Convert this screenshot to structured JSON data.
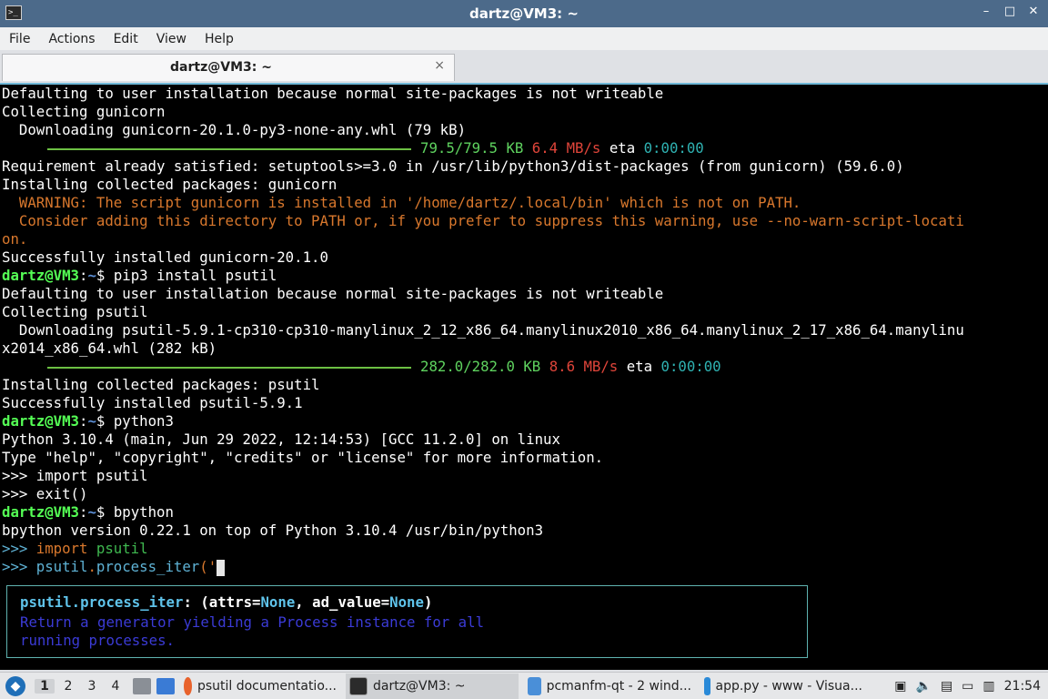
{
  "window": {
    "title": "dartz@VM3: ~",
    "min": "–",
    "max": "□",
    "close": "✕"
  },
  "menu": [
    "File",
    "Actions",
    "Edit",
    "View",
    "Help"
  ],
  "tab": {
    "label": "dartz@VM3: ~",
    "close": "×"
  },
  "prompt": {
    "user": "dartz@VM3",
    "path": "~",
    "sep": ":",
    "dollar": "$"
  },
  "lines": {
    "l1": "Defaulting to user installation because normal site-packages is not writeable",
    "l2": "Collecting gunicorn",
    "l3": "  Downloading gunicorn-20.1.0-py3-none-any.whl (79 kB)",
    "l4_size": "79.5/79.5 KB",
    "l4_speed": "6.4 MB/s",
    "l4_eta_label": "eta",
    "l4_eta": "0:00:00",
    "l5": "Requirement already satisfied: setuptools>=3.0 in /usr/lib/python3/dist-packages (from gunicorn) (59.6.0)",
    "l6": "Installing collected packages: gunicorn",
    "l7": "  WARNING: The script gunicorn is installed in '/home/dartz/.local/bin' which is not on PATH.",
    "l8": "  Consider adding this directory to PATH or, if you prefer to suppress this warning, use --no-warn-script-locati",
    "l9": "on.",
    "l10": "Successfully installed gunicorn-20.1.0",
    "cmd1": " pip3 install psutil",
    "l12": "Defaulting to user installation because normal site-packages is not writeable",
    "l13": "Collecting psutil",
    "l14": "  Downloading psutil-5.9.1-cp310-cp310-manylinux_2_12_x86_64.manylinux2010_x86_64.manylinux_2_17_x86_64.manylinu",
    "l15": "x2014_x86_64.whl (282 kB)",
    "l16_size": "282.0/282.0 KB",
    "l16_speed": "8.6 MB/s",
    "l16_eta_label": "eta",
    "l16_eta": "0:00:00",
    "l17": "Installing collected packages: psutil",
    "l18": "Successfully installed psutil-5.9.1",
    "cmd2": " python3",
    "l20": "Python 3.10.4 (main, Jun 29 2022, 12:14:53) [GCC 11.2.0] on linux",
    "l21": "Type \"help\", \"copyright\", \"credits\" or \"license\" for more information.",
    "l22": ">>> import psutil",
    "l23": ">>> exit()",
    "cmd3": " bpython",
    "l25": "bpython version 0.22.1 on top of Python 3.10.4 /usr/bin/python3",
    "bp_prompt": ">>> ",
    "bp_import_kw": "import",
    "bp_import_mod": " psutil",
    "bp_mod": "psutil",
    "bp_dot": ".",
    "bp_fn": "process_iter",
    "bp_paren": "('"
  },
  "tooltip": {
    "fn": "psutil.process_iter",
    "colon": ": (",
    "arg1": "attrs",
    "eq1": "=",
    "val1": "None",
    "comma": ", ",
    "arg2": "ad_value",
    "eq2": "=",
    "val2": "None",
    "close": ")",
    "doc1": "Return a generator yielding a Process instance for all",
    "doc2": "running processes."
  },
  "taskbar": {
    "desktops": [
      "1",
      "2",
      "3",
      "4"
    ],
    "tasks": [
      "psutil documentatio...",
      "dartz@VM3: ~",
      "pcmanfm-qt - 2 wind...",
      "app.py - www - Visua..."
    ],
    "clock": "21:54"
  }
}
